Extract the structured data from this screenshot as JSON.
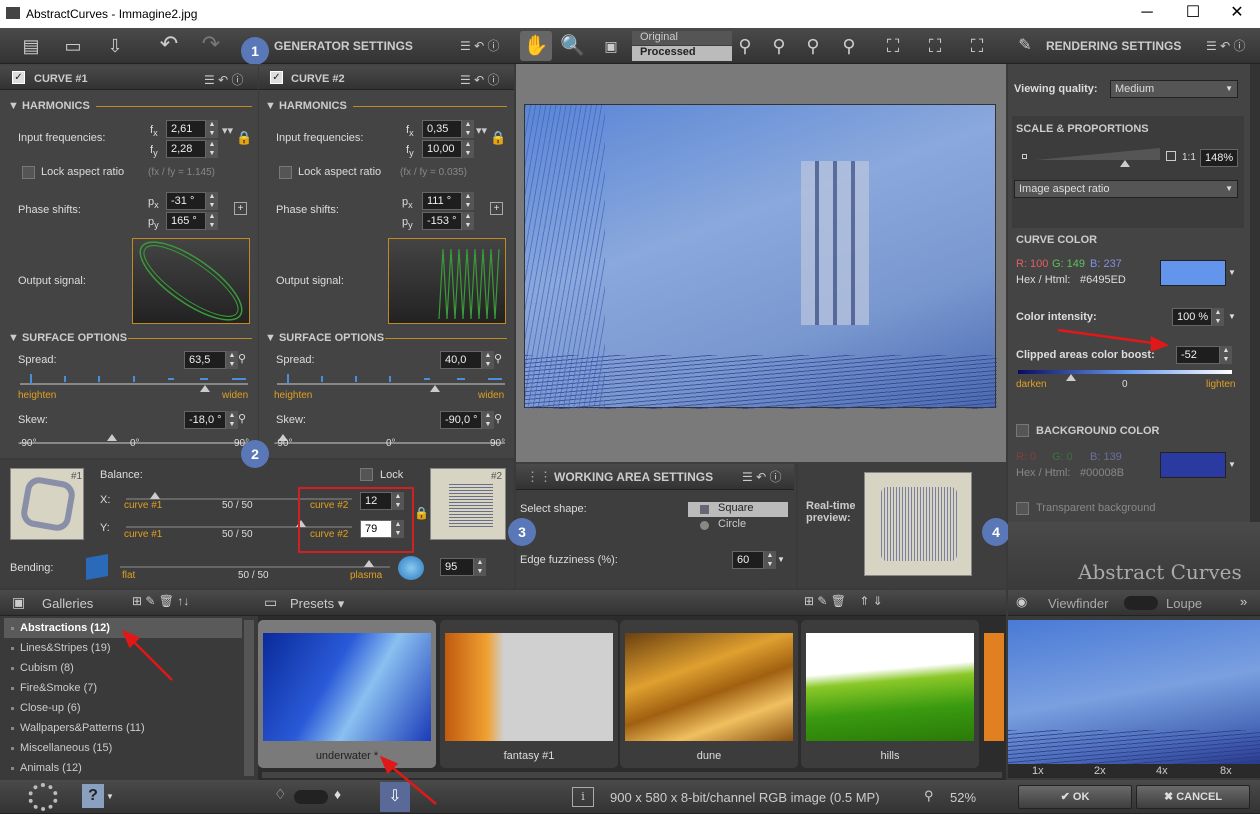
{
  "window": {
    "title": "AbstractCurves - Immagine2.jpg",
    "minimize": "─",
    "maximize": "☐",
    "close": "✕"
  },
  "generator": {
    "title": "GENERATOR SETTINGS",
    "step": "1"
  },
  "curve1": {
    "title": "CURVE #1",
    "harmonics": "HARMONICS",
    "input_freq": "Input frequencies:",
    "fx": "2,61",
    "fy": "2,28",
    "lock_aspect": "Lock aspect ratio",
    "ratio": "(fx / fy = 1.145)",
    "phase": "Phase shifts:",
    "px": "-31 °",
    "py": "165 °",
    "output": "Output signal:",
    "surface": "SURFACE OPTIONS",
    "spread_label": "Spread:",
    "spread": "63,5",
    "heighten": "heighten",
    "widen": "widen",
    "skew_label": "Skew:",
    "skew": "-18,0 °",
    "t1": "-90°",
    "t2": "0°",
    "t3": "90°"
  },
  "curve2": {
    "title": "CURVE #2",
    "harmonics": "HARMONICS",
    "input_freq": "Input frequencies:",
    "fx": "0,35",
    "fy": "10,00",
    "lock_aspect": "Lock aspect ratio",
    "ratio": "(fx / fy = 0.035)",
    "phase": "Phase shifts:",
    "px": "111 °",
    "py": "-153 °",
    "output": "Output signal:",
    "surface": "SURFACE OPTIONS",
    "spread_label": "Spread:",
    "spread": "40,0",
    "heighten": "heighten",
    "widen": "widen",
    "skew_label": "Skew:",
    "skew": "-90,0 °",
    "t1": "-90°",
    "t2": "0°",
    "t3": "90°"
  },
  "balance": {
    "step": "2",
    "label": "Balance:",
    "lock": "Lock",
    "x": "X:",
    "y": "Y:",
    "c1": "curve #1",
    "c2": "curve #2",
    "mid": "50 / 50",
    "xval": "12",
    "yval": "79",
    "thumb1": "#1",
    "thumb2": "#2",
    "bending": "Bending:",
    "flat": "flat",
    "plasma": "plasma",
    "bend_mid": "50 / 50",
    "bend_val": "95"
  },
  "viewer": {
    "original": "Original",
    "processed": "Processed"
  },
  "working": {
    "title": "WORKING AREA SETTINGS",
    "step": "3",
    "shape": "Select shape:",
    "square": "Square",
    "circle": "Circle",
    "fuzz": "Edge fuzziness (%):",
    "fuzz_val": "60",
    "preview": "Real-time preview:"
  },
  "rendering": {
    "title": "RENDERING SETTINGS",
    "step": "4",
    "quality_label": "Viewing quality:",
    "quality": "Medium",
    "scale": "SCALE & PROPORTIONS",
    "ratio11": "1:1",
    "zoom": "148%",
    "aspect": "Image aspect ratio",
    "curve_color": "CURVE COLOR",
    "r": "R: 100",
    "g": "G: 149",
    "b": "B: 237",
    "hex_label": "Hex / Html:",
    "hex": "#6495ED",
    "curve_rgb": "#6495ED",
    "intensity_label": "Color intensity:",
    "intensity": "100 %",
    "clip_label": "Clipped areas color boost:",
    "clip": "-52",
    "darken": "darken",
    "zero": "0",
    "lighten": "lighten",
    "bg_color": "BACKGROUND COLOR",
    "bg_r": "R:   0",
    "bg_g": "G:   0",
    "bg_b": "B: 139",
    "bg_hex": "#00008B",
    "bg_rgb": "#00008B",
    "transparent": "Transparent background",
    "logo": "Abstract Curves"
  },
  "galleries": {
    "title": "Galleries",
    "items": [
      {
        "label": "Abstractions (12)"
      },
      {
        "label": "Lines&Stripes (19)"
      },
      {
        "label": "Cubism (8)"
      },
      {
        "label": "Fire&Smoke (7)"
      },
      {
        "label": "Close-up (6)"
      },
      {
        "label": "Wallpapers&Patterns (11)"
      },
      {
        "label": "Miscellaneous (15)"
      },
      {
        "label": "Animals (12)"
      }
    ]
  },
  "presets": {
    "title": "Presets",
    "items": [
      {
        "label": "underwater *"
      },
      {
        "label": "fantasy #1"
      },
      {
        "label": "dune"
      },
      {
        "label": "hills"
      }
    ]
  },
  "viewfinder": {
    "title": "Viewfinder",
    "loupe": "Loupe",
    "zooms": [
      "1x",
      "2x",
      "4x",
      "8x"
    ]
  },
  "status": {
    "info": "900 x 580 x 8-bit/channel RGB image  (0.5 MP)",
    "zoom": "52%"
  },
  "buttons": {
    "ok": "OK",
    "cancel": "CANCEL"
  }
}
